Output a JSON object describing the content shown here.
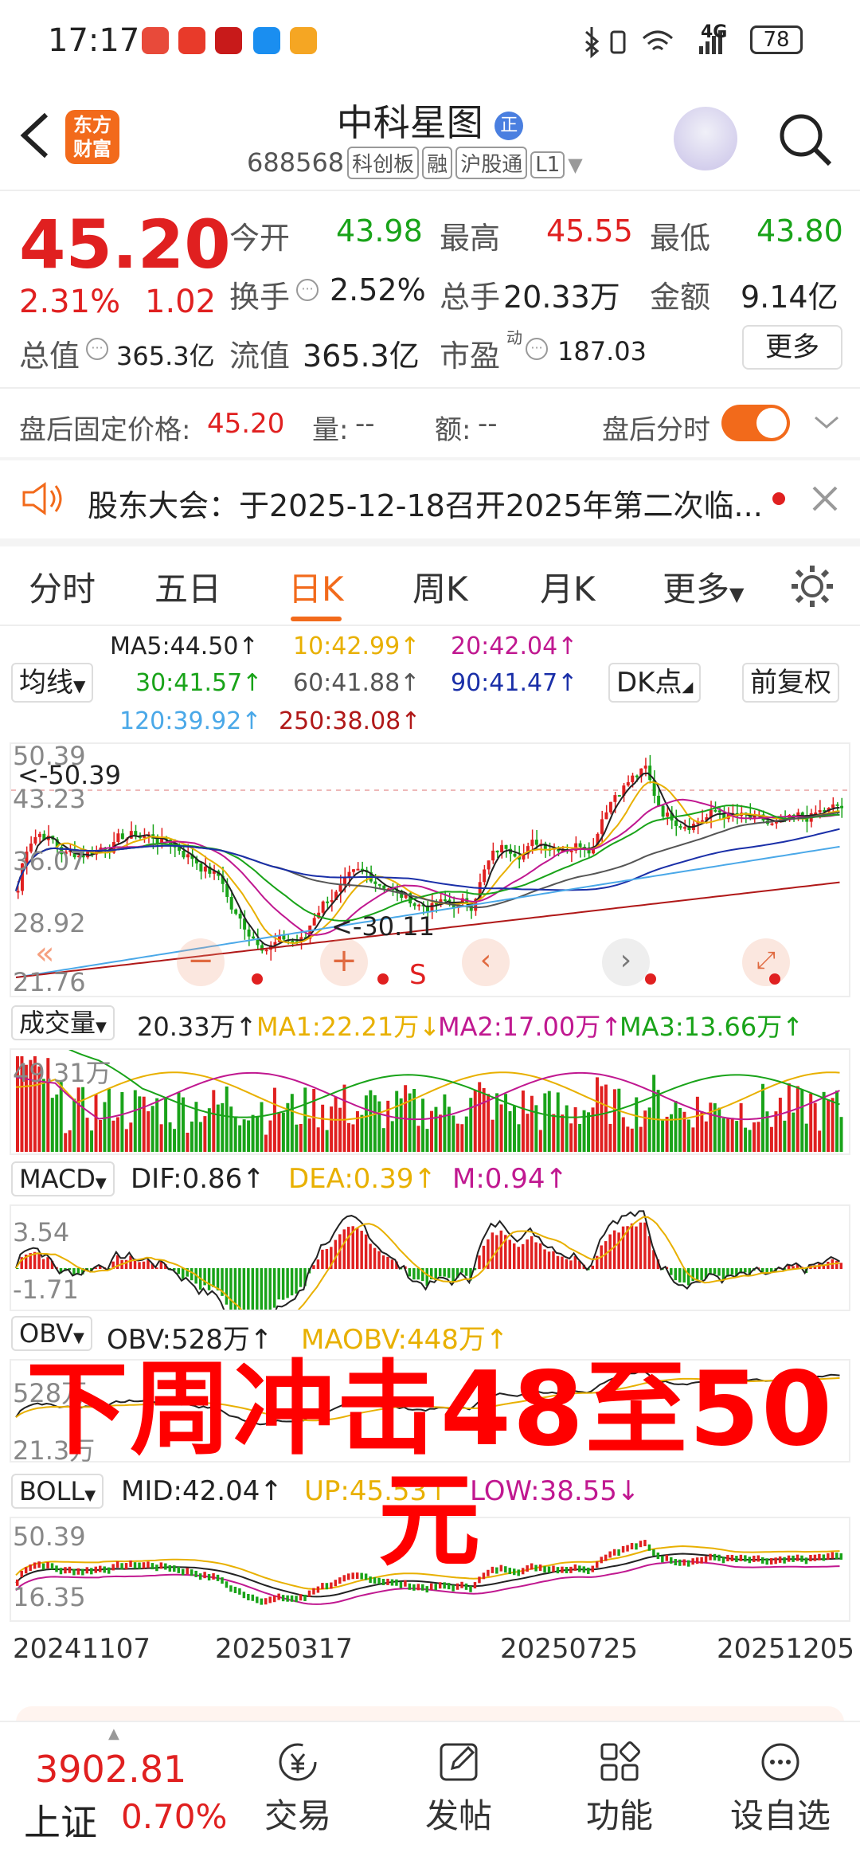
{
  "status": {
    "time": "17:17",
    "battery": "78",
    "net": "4G"
  },
  "header": {
    "brand": "东方财富",
    "title": "中科星图",
    "title_tag": "正",
    "code": "688568",
    "tags": [
      "科创板",
      "融",
      "沪股通",
      "L1"
    ]
  },
  "quote": {
    "price": "45.20",
    "change_pct": "2.31%",
    "change": "1.02",
    "open_label": "今开",
    "open": "43.98",
    "high_label": "最高",
    "high": "45.55",
    "low_label": "最低",
    "low": "43.80",
    "turnover_label": "换手",
    "turnover": "2.52%",
    "volume_label": "总手",
    "volume": "20.33万",
    "amount_label": "金额",
    "amount": "9.14亿",
    "mktcap_label": "总值",
    "mktcap": "365.3亿",
    "float_label": "流值",
    "float": "365.3亿",
    "pe_label": "市盈",
    "pe_sup": "动",
    "pe": "187.03",
    "more": "更多"
  },
  "afterhours": {
    "label": "盘后固定价格:",
    "price": "45.20",
    "vol_label": "量:",
    "vol": "--",
    "amt_label": "额:",
    "amt": "--",
    "toggle_label": "盘后分时"
  },
  "notice": {
    "text": "股东大会：于2025-12-18召开2025年第二次临..."
  },
  "tabs": [
    "分时",
    "五日",
    "日K",
    "周K",
    "月K",
    "更多"
  ],
  "kline": {
    "ma_select": "均线",
    "ma": {
      "ma5": "MA5:44.50↑",
      "ma10": "10:42.99↑",
      "ma20": "20:42.04↑",
      "ma30": "30:41.57↑",
      "ma60": "60:41.88↑",
      "ma90": "90:41.47↑",
      "ma120": "120:39.92↑",
      "ma250": "250:38.08↑"
    },
    "dk_button": "DK点",
    "adjust_button": "前复权",
    "y_labels": [
      "50.39",
      "43.23",
      "36.07",
      "28.92",
      "21.76"
    ],
    "max_marker": "<-50.39",
    "min_marker": "<-30.11",
    "s_marker": "S"
  },
  "volume": {
    "select": "成交量",
    "value": "20.33万↑",
    "ma1": "MA1:22.21万↓",
    "ma2": "MA2:17.00万↑",
    "ma3": "MA3:13.66万↑",
    "y_label": "49.31万"
  },
  "macd": {
    "select": "MACD",
    "dif": "DIF:0.86↑",
    "dea": "DEA:0.39↑",
    "m": "M:0.94↑",
    "y_top": "3.54",
    "y_bottom": "-1.71"
  },
  "obv": {
    "select": "OBV",
    "obv": "OBV:528万↑",
    "maobv": "MAOBV:448万↑",
    "y_top": "528万",
    "y_bottom": "21.3万"
  },
  "boll": {
    "select": "BOLL",
    "mid": "MID:42.04↑",
    "up": "UP:45.53↑",
    "low": "LOW:38.55↓",
    "y_top": "50.39",
    "y_bottom": "16.35"
  },
  "overlay_text": "下周冲击48至50元",
  "dates": [
    "20241107",
    "20250317",
    "20250725",
    "20251205"
  ],
  "bottom": {
    "index_price": "3902.81",
    "index_name": "上证",
    "index_pct": "0.70%",
    "trade": "交易",
    "post": "发帖",
    "func": "功能",
    "watch": "设自选"
  },
  "colors": {
    "up": "#e02020",
    "down": "#19a319",
    "accent": "#f26a1b"
  }
}
